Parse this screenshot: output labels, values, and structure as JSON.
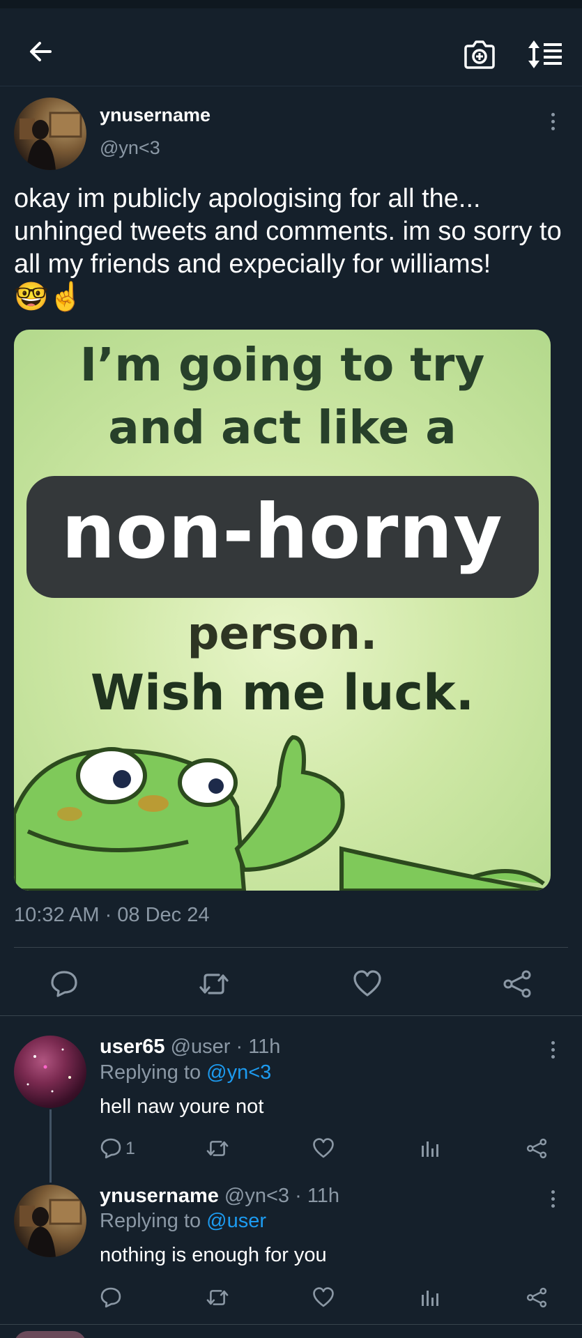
{
  "main_tweet": {
    "display_name": "ynusername",
    "handle": "@yn<3",
    "text": "okay im publicly apologising for all the... unhinged tweets and comments. im so sorry to all my friends and expecially for williams!",
    "emojis": "🤓☝️",
    "meme": {
      "line1": "I’m going to try",
      "line2": "and act like a",
      "band": "non-horny",
      "line3": "person.",
      "line4": "Wish me luck."
    },
    "timestamp": "10:32 AM · 08 Dec 24"
  },
  "replies": [
    {
      "display_name": "user65",
      "handle_time": "@user · 11h",
      "replying_prefix": "Replying to ",
      "replying_to": "@yn<3",
      "text": "hell naw youre not",
      "reply_count": "1"
    },
    {
      "display_name": "ynusername",
      "handle_time": "@yn<3 · 11h",
      "replying_prefix": "Replying to ",
      "replying_to": "@user",
      "text": "nothing is enough for you",
      "reply_count": ""
    }
  ],
  "icons": {
    "back": "arrow-left-icon",
    "camera": "camera-plus-icon",
    "sort": "sort-list-icon",
    "reply": "comment-icon",
    "retweet": "retweet-icon",
    "like": "heart-icon",
    "views": "views-icon",
    "share": "share-icon"
  },
  "colors": {
    "background": "#15202b",
    "text_muted": "#8b98a5",
    "link": "#1d9bf0",
    "divider": "#38444d"
  }
}
